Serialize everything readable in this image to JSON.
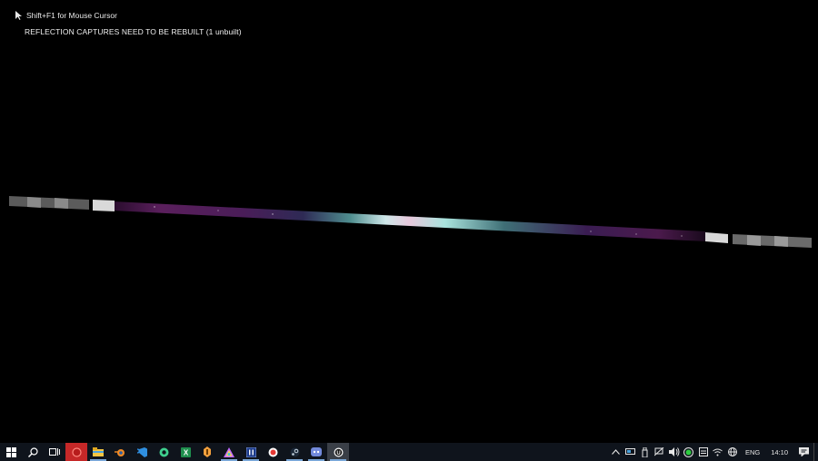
{
  "overlay": {
    "hint_text": "Shift+F1 for Mouse Cursor",
    "warning_text": "REFLECTION CAPTURES NEED TO BE REBUILT (1 unbuilt)"
  },
  "taskbar": {
    "apps": [
      {
        "name": "start-icon",
        "color": "#ffffff"
      },
      {
        "name": "search-icon",
        "color": "#ffffff"
      },
      {
        "name": "task-view-icon",
        "color": "#ffffff"
      },
      {
        "name": "red-app-icon",
        "color": "#e53935"
      },
      {
        "name": "file-explorer-icon",
        "color": "#f4c542"
      },
      {
        "name": "blender-icon",
        "color": "#f08a24"
      },
      {
        "name": "vscode-icon",
        "color": "#2f8fe0"
      },
      {
        "name": "green-app-icon",
        "color": "#3fcf8e"
      },
      {
        "name": "excel-icon",
        "color": "#1f8f4e"
      },
      {
        "name": "orange-app-icon",
        "color": "#f2a03d"
      },
      {
        "name": "colorful-app-icon",
        "color": "#c26dff"
      },
      {
        "name": "dark-blue-app-icon",
        "color": "#1b3a8a"
      },
      {
        "name": "record-app-icon",
        "color": "#e53935"
      },
      {
        "name": "steam-icon",
        "color": "#c7d5e0"
      },
      {
        "name": "discord-icon",
        "color": "#7289da"
      },
      {
        "name": "unreal-engine-icon",
        "color": "#ffffff"
      }
    ]
  },
  "tray": {
    "language": "ENG",
    "time": "14:10"
  }
}
